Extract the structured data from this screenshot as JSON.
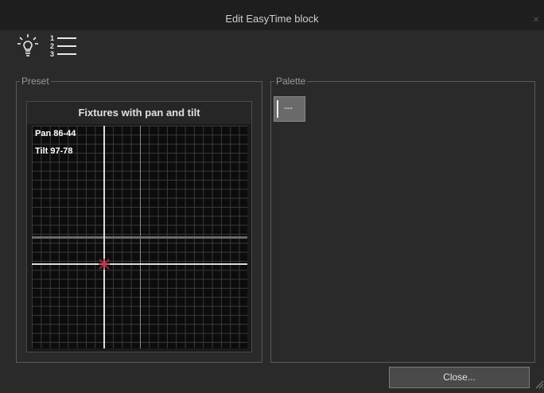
{
  "window": {
    "title": "Edit EasyTime block",
    "close_glyph": "×"
  },
  "toolbar": {
    "icons": [
      "lightbulb-icon",
      "numbered-list-icon"
    ]
  },
  "preset": {
    "group_label": "Preset",
    "panel_title": "Fixtures with pan and tilt",
    "pan_readout": "Pan 86-44",
    "tilt_readout": "Tilt 97-78",
    "marker_color": "#c03040"
  },
  "palette": {
    "group_label": "Palette",
    "items": [
      {
        "label": "---"
      }
    ]
  },
  "footer": {
    "close_label": "Close..."
  }
}
